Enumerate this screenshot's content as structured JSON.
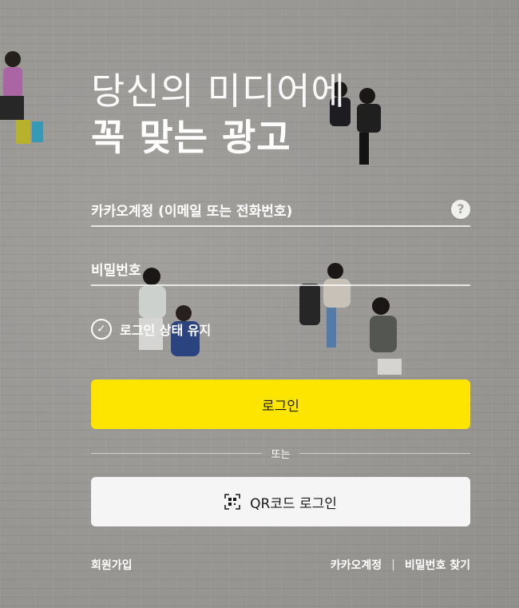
{
  "headline": {
    "line1": "당신의 미디어에",
    "line2": "꼭 맞는 광고"
  },
  "login_form": {
    "id_placeholder": "카카오계정 (이메일 또는 전화번호)",
    "password_placeholder": "비밀번호",
    "help_icon": "question-icon",
    "keep_logged_in_label": "로그인 상태 유지",
    "keep_logged_in_checked": true,
    "login_button_label": "로그인",
    "divider_text": "또는",
    "qr_button_label": "QR코드 로그인"
  },
  "footer": {
    "signup_link": "회원가입",
    "find_account_link": "카카오계정",
    "separator": "|",
    "find_password_link": "비밀번호 찾기"
  },
  "colors": {
    "login_button": "#fee500",
    "qr_button": "#f5f5f5",
    "text_on_bg": "#ffffff"
  }
}
